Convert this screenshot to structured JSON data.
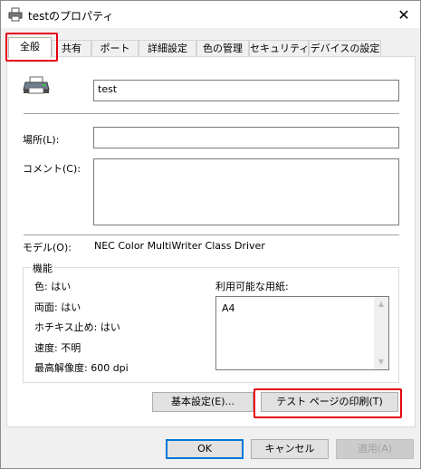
{
  "window": {
    "title": "testのプロパティ",
    "close_glyph": "✕"
  },
  "tabs": [
    {
      "label": "全般",
      "active": true
    },
    {
      "label": "共有"
    },
    {
      "label": "ポート"
    },
    {
      "label": "詳細設定"
    },
    {
      "label": "色の管理"
    },
    {
      "label": "セキュリティ"
    },
    {
      "label": "デバイスの設定"
    }
  ],
  "general": {
    "printer_name": "test",
    "location_label": "場所(L):",
    "location_value": "",
    "comment_label": "コメント(C):",
    "comment_value": "",
    "model_label": "モデル(O):",
    "model_value": "NEC Color MultiWriter Class Driver"
  },
  "features": {
    "title": "機能",
    "color": "色: はい",
    "duplex": "両面: はい",
    "staple": "ホチキス止め: はい",
    "speed": "速度: 不明",
    "resolution": "最高解像度: 600 dpi",
    "paper_label": "利用可能な用紙:",
    "papers": [
      "A4"
    ]
  },
  "buttons": {
    "preferences": "基本設定(E)...",
    "print_test": "テスト ページの印刷(T)",
    "ok": "OK",
    "cancel": "キャンセル",
    "apply": "適用(A)"
  },
  "colors": {
    "highlight": "#e60012",
    "accent": "#0078d7"
  }
}
